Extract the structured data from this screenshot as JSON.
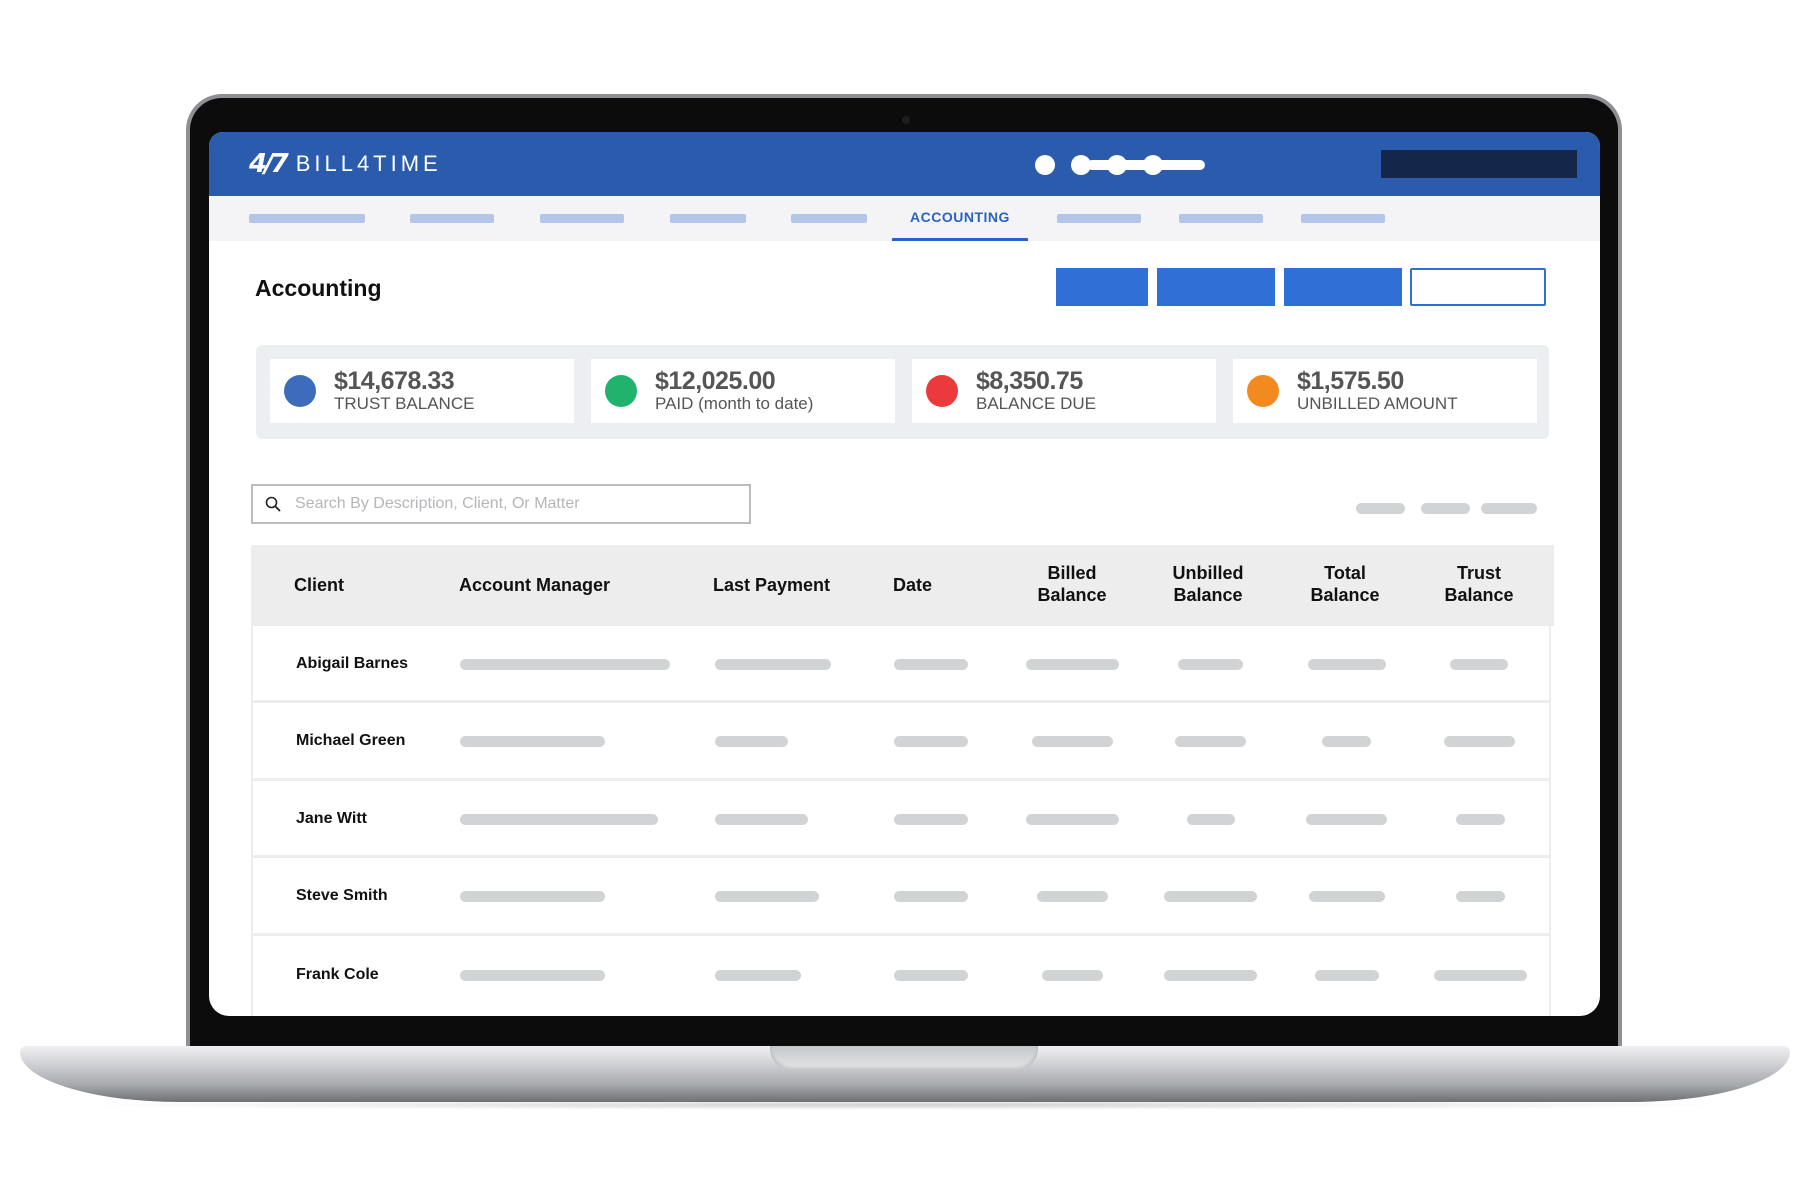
{
  "app": {
    "brand_mark": "4/7",
    "brand_name": "BILL4TIME"
  },
  "nav": {
    "active_tab": "ACCOUNTING"
  },
  "page": {
    "title": "Accounting"
  },
  "summary": [
    {
      "value": "$14,678.33",
      "label": "TRUST BALANCE",
      "color": "#3e6cbd"
    },
    {
      "value": "$12,025.00",
      "label": "PAID (month to date)",
      "color": "#1fb36b"
    },
    {
      "value": "$8,350.75",
      "label": "BALANCE DUE",
      "color": "#ea3a3d"
    },
    {
      "value": "$1,575.50",
      "label": "UNBILLED AMOUNT",
      "color": "#f28a1f"
    }
  ],
  "search": {
    "placeholder": "Search By Description, Client, Or Matter",
    "value": ""
  },
  "table": {
    "headers": {
      "client": "Client",
      "account_manager": "Account Manager",
      "last_payment": "Last Payment",
      "date": "Date",
      "billed_balance_1": "Billed",
      "billed_balance_2": "Balance",
      "unbilled_balance_1": "Unbilled",
      "unbilled_balance_2": "Balance",
      "total_balance_1": "Total",
      "total_balance_2": "Balance",
      "trust_balance_1": "Trust",
      "trust_balance_2": "Balance"
    },
    "rows": [
      {
        "client": "Abigail Barnes"
      },
      {
        "client": "Michael Green"
      },
      {
        "client": "Jane Witt"
      },
      {
        "client": "Steve Smith"
      },
      {
        "client": "Frank Cole"
      }
    ]
  },
  "colors": {
    "header_blue": "#2a5bac",
    "accent_blue": "#2f6fd6",
    "nav_active": "#2a63c4"
  }
}
